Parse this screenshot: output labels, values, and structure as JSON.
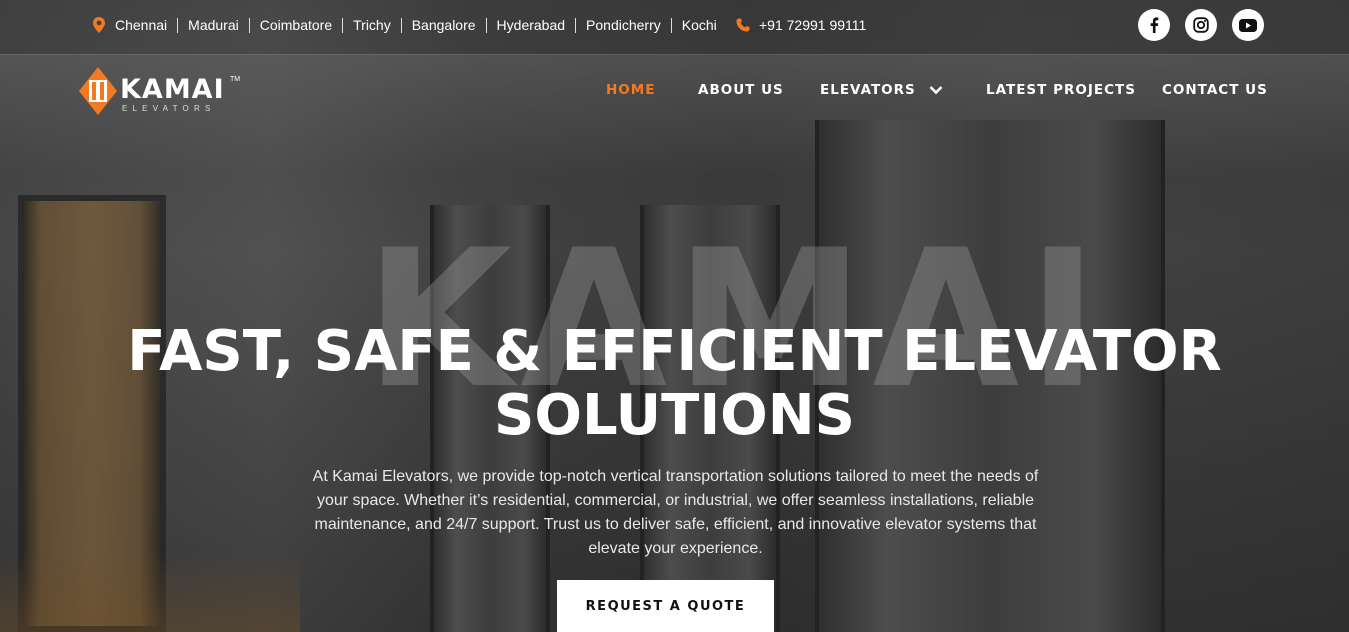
{
  "topbar": {
    "locations": [
      "Chennai",
      "Madurai",
      "Coimbatore",
      "Trichy",
      "Bangalore",
      "Hyderabad",
      "Pondicherry",
      "Kochi"
    ],
    "phone": "+91 72991 99111",
    "socials": [
      "facebook-icon",
      "instagram-icon",
      "youtube-icon"
    ]
  },
  "logo": {
    "name": "KAMAI",
    "tm": "TM",
    "tagline": "ELEVATORS"
  },
  "nav": {
    "items": [
      {
        "label": "HOME",
        "active": true
      },
      {
        "label": "ABOUT US"
      },
      {
        "label": "ELEVATORS",
        "dropdown": true
      },
      {
        "label": "LATEST PROJECTS"
      },
      {
        "label": "CONTACT US"
      }
    ]
  },
  "hero": {
    "watermark": "KAMAI",
    "title_line1": "FAST, SAFE & EFFICIENT ELEVATOR",
    "title_line2": "SOLUTIONS",
    "description": "At Kamai Elevators, we provide top-notch vertical transportation solutions tailored to meet the needs of your space. Whether it’s residential, commercial, or industrial, we offer seamless installations, reliable maintenance, and 24/7 support. Trust us to deliver safe, efficient, and innovative elevator systems that elevate your experience.",
    "cta_label": "REQUEST A QUOTE"
  },
  "colors": {
    "accent": "#f37a22",
    "text": "#ffffff"
  }
}
